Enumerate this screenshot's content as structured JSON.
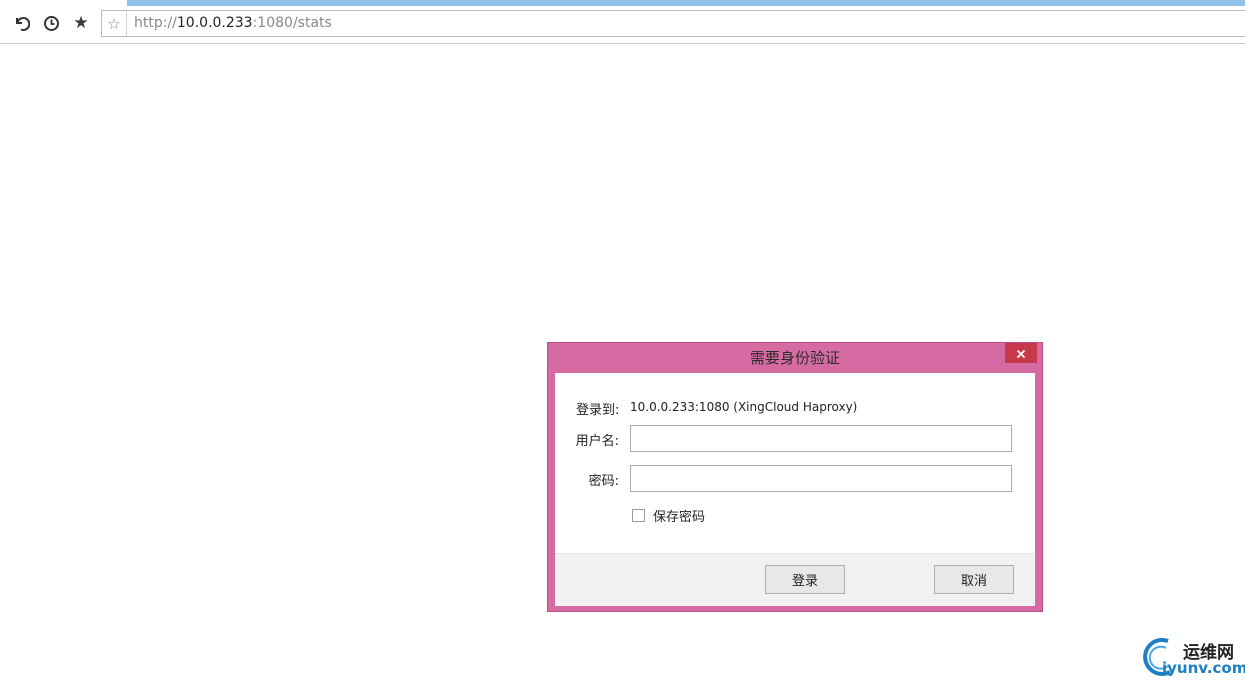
{
  "browser": {
    "url_prefix": "http://",
    "url_host": "10.0.0.233",
    "url_suffix": ":1080/stats",
    "icons": [
      "undo-icon",
      "history-icon",
      "favorites-star-icon",
      "bookmark-star-icon"
    ]
  },
  "dialog": {
    "title": "需要身份验证",
    "login_to_label": "登录到:",
    "login_to_value": "10.0.0.233:1080 (XingCloud Haproxy)",
    "username_label": "用户名:",
    "username_value": "",
    "password_label": "密码:",
    "password_value": "",
    "remember_label": "保存密码",
    "remember_checked": false,
    "login_button": "登录",
    "cancel_button": "取消",
    "colors": {
      "frame": "#d66aa3",
      "close": "#c7384a"
    }
  },
  "watermark": {
    "title": "运维网",
    "url": "iyunv.com"
  }
}
